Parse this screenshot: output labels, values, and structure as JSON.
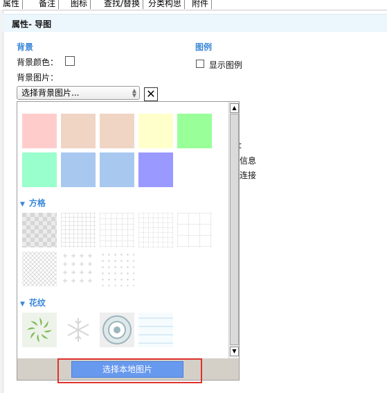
{
  "tabs": [
    "属性",
    "备注",
    "图标",
    "查找/替换",
    "分类构思",
    "附件"
  ],
  "header": {
    "title": "属性- 导图"
  },
  "background": {
    "section_title": "背景",
    "color_label": "背景颜色：",
    "image_label": "背景图片：",
    "select_value": "选择背景图片..."
  },
  "legend": {
    "section_title": "图例",
    "show_label": "显示图例"
  },
  "behind_texts": [
    "t",
    "信息",
    "连接"
  ],
  "popup": {
    "colors": [
      "#ffcccc",
      "#f0d5c5",
      "#f0d5c5",
      "#ffffcc",
      "#99ff99",
      "#99ffcc",
      "#a8c8f0",
      "#a8c8f0",
      "#9999ff"
    ],
    "groups": [
      "方格",
      "花纹"
    ],
    "local_button": "选择本地图片"
  },
  "colors": {
    "accent": "#3b87d8",
    "button": "#6799ee",
    "highlight": "#e0322c"
  }
}
